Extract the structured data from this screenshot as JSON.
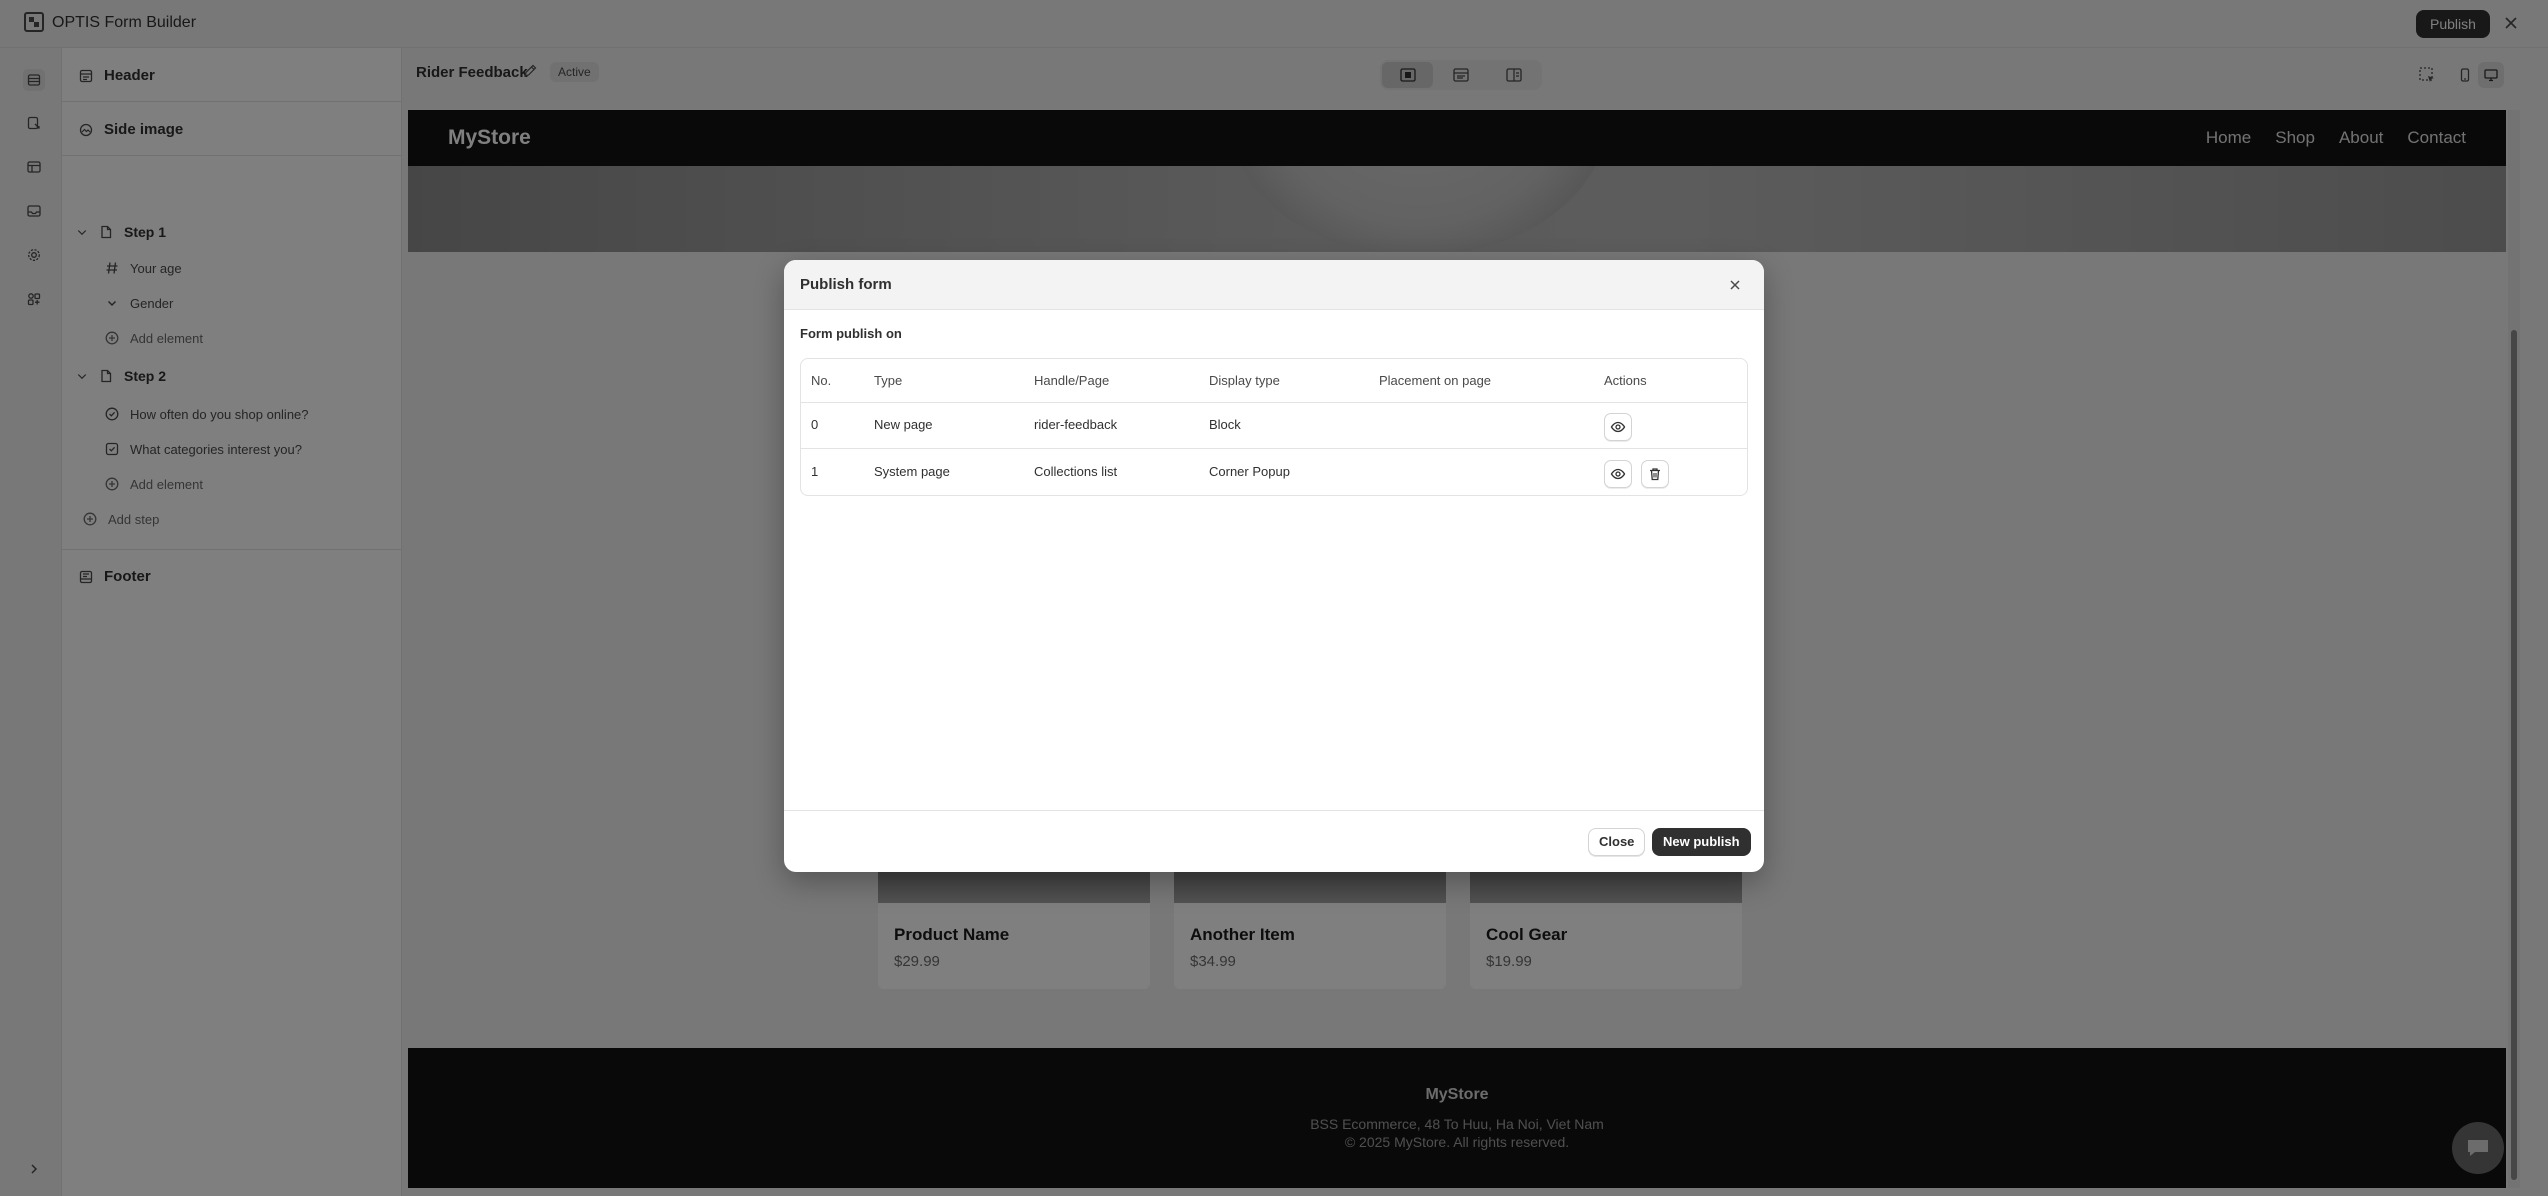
{
  "app": {
    "title": "OPTIS Form Builder",
    "publish_label": "Publish"
  },
  "sidebar": {
    "header_label": "Header",
    "side_image_label": "Side image",
    "steps": [
      {
        "label": "Step 1",
        "items": [
          "Your age",
          "Gender"
        ],
        "add_label": "Add element"
      },
      {
        "label": "Step 2",
        "items": [
          "How often do you shop online?",
          "What categories interest you?"
        ],
        "add_label": "Add element"
      }
    ],
    "add_step_label": "Add step",
    "footer_label": "Footer"
  },
  "canvas": {
    "form_name": "Rider Feedback",
    "status": "Active"
  },
  "store": {
    "logo": "MyStore",
    "nav": [
      "Home",
      "Shop",
      "About",
      "Contact"
    ],
    "products": [
      {
        "name": "Product Name",
        "price": "$29.99"
      },
      {
        "name": "Another Item",
        "price": "$34.99"
      },
      {
        "name": "Cool Gear",
        "price": "$19.99"
      }
    ],
    "footer": {
      "brand": "MyStore",
      "address": "BSS Ecommerce, 48 To Huu, Ha Noi, Viet Nam",
      "copyright": "© 2025 MyStore. All rights reserved."
    }
  },
  "modal": {
    "title": "Publish form",
    "section_title": "Form publish on",
    "columns": [
      "No.",
      "Type",
      "Handle/Page",
      "Display type",
      "Placement on page",
      "Actions"
    ],
    "rows": [
      {
        "no": "0",
        "type": "New page",
        "handle": "rider-feedback",
        "display": "Block",
        "placement": ""
      },
      {
        "no": "1",
        "type": "System page",
        "handle": "Collections list",
        "display": "Corner Popup",
        "placement": ""
      }
    ],
    "close_label": "Close",
    "new_publish_label": "New publish"
  }
}
